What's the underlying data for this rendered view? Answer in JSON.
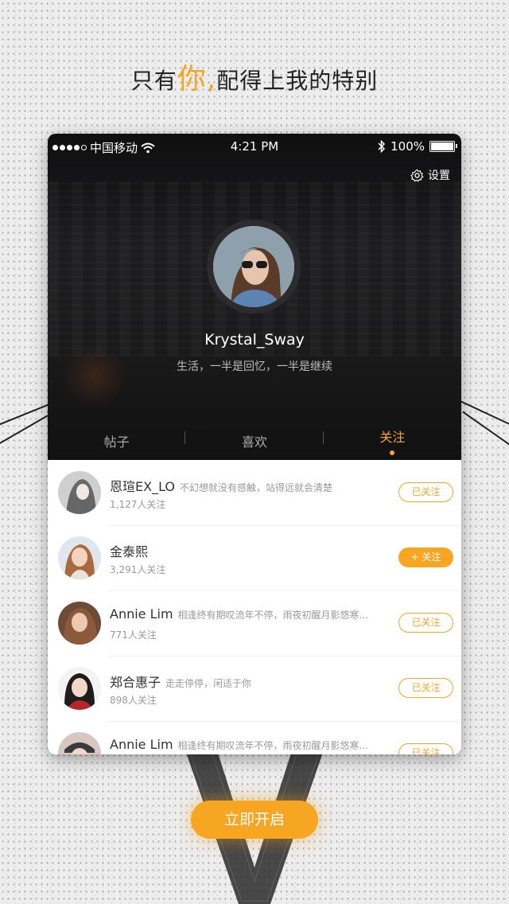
{
  "header": {
    "before": "只有",
    "accent": "你,",
    "after": "配得上我的特别"
  },
  "status_bar": {
    "carrier": "中国移动",
    "time": "4:21 PM",
    "battery": "100%",
    "signal_bars": 4
  },
  "profile": {
    "settings_label": "设置",
    "username": "Krystal_Sway",
    "bio": "生活，一半是回忆，一半是继续"
  },
  "tabs": [
    {
      "label": "帖子"
    },
    {
      "label": "喜欢"
    },
    {
      "label": "关注"
    }
  ],
  "active_tab": "关注",
  "follow_list": [
    {
      "name": "恩瑄EX_LO",
      "desc": "不幻想就没有感触，站得远就会清楚",
      "followers": "1,127人关注",
      "button": "已关注"
    },
    {
      "name": "金泰熙",
      "desc": "",
      "followers": "3,291人关注",
      "button": "+ 关注"
    },
    {
      "name": "Annie Lim",
      "desc": "相逢终有期叹流年不停，雨夜初醒月影悠寒...",
      "followers": "771人关注",
      "button": "已关注"
    },
    {
      "name": "郑合惠子",
      "desc": "走走停停，闲适于你",
      "followers": "898人关注",
      "button": "已关注"
    },
    {
      "name": "Annie Lim",
      "desc": "相逢终有期叹流年不停，雨夜初醒月影悠寒...",
      "followers": "",
      "button": "已关注"
    }
  ],
  "cta": {
    "label": "立即开启"
  },
  "colors": {
    "accent": "#f6a623",
    "hero_bg": "#1a1a1b",
    "text_dark": "#333333"
  }
}
